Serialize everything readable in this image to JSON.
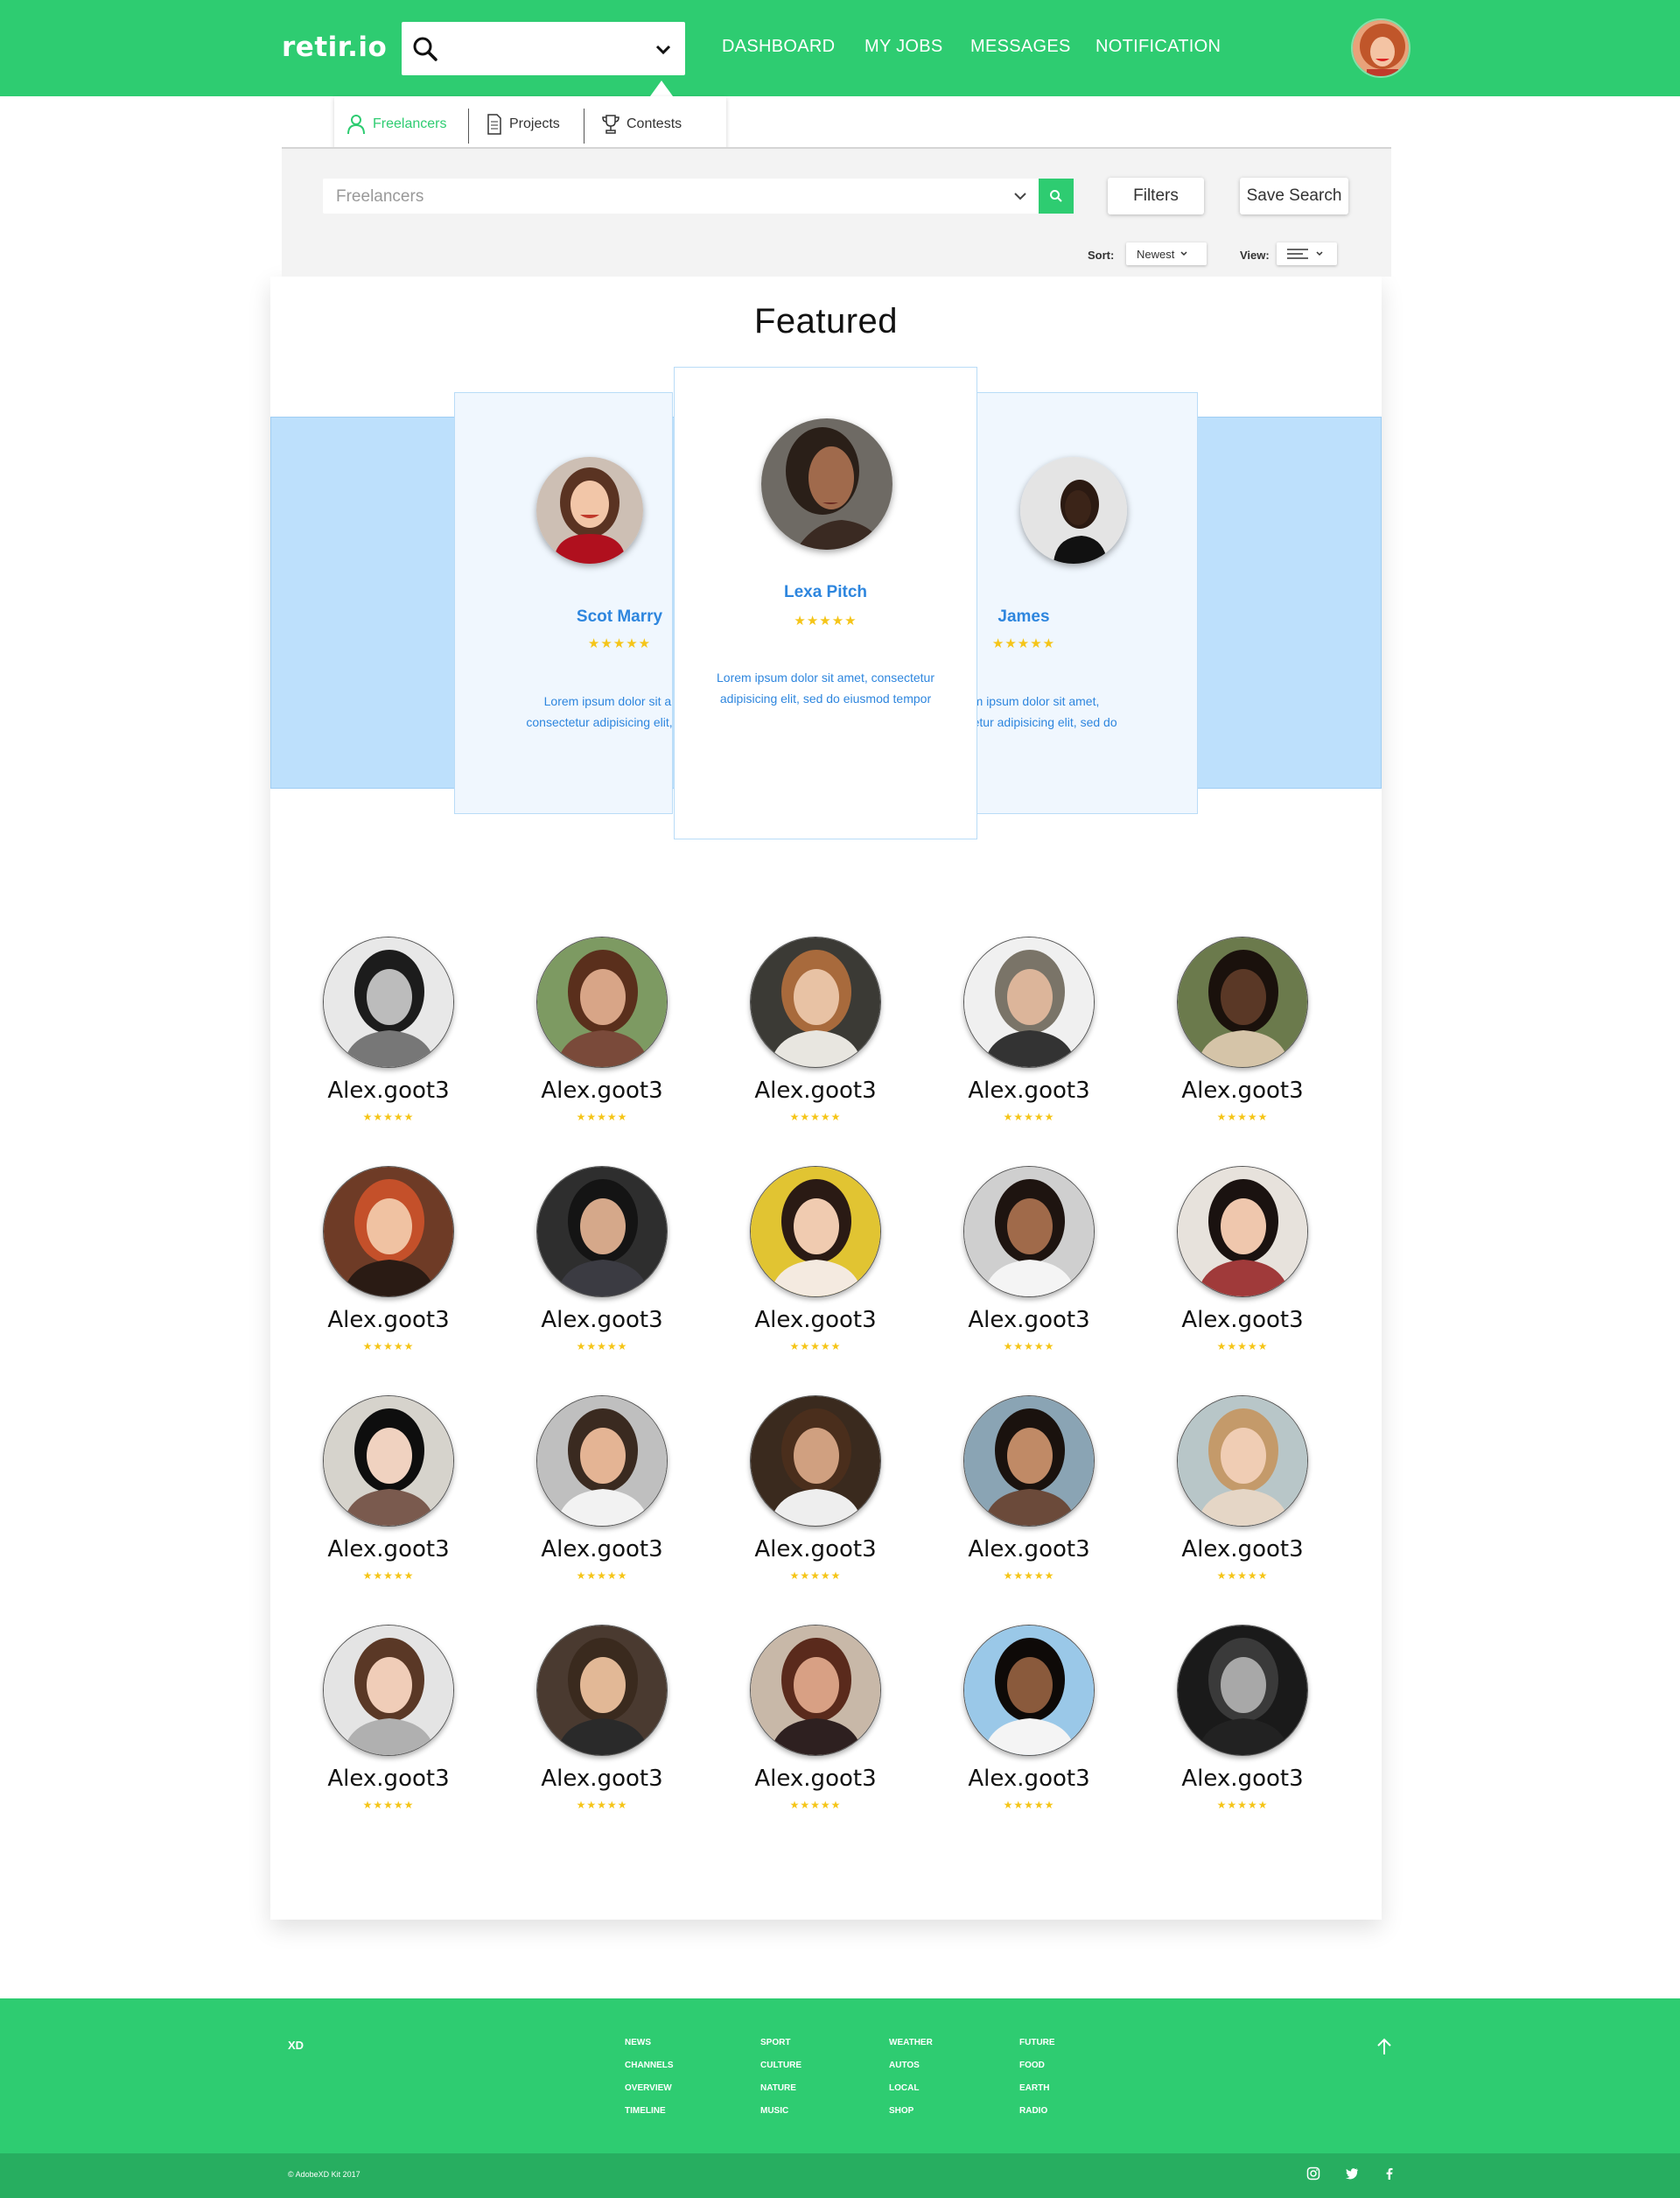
{
  "app": {
    "logo": "retir.io",
    "nav": [
      "DASHBOARD",
      "MY JOBS",
      "MESSAGES",
      "NOTIFICATION"
    ],
    "search": {
      "value": "",
      "placeholder": ""
    }
  },
  "search_tabs": [
    {
      "label": "Freelancers",
      "icon": "user-icon",
      "active": true
    },
    {
      "label": "Projects",
      "icon": "document-icon",
      "active": false
    },
    {
      "label": "Contests",
      "icon": "trophy-icon",
      "active": false
    }
  ],
  "toolbar": {
    "category": "Freelancers",
    "filters_label": "Filters",
    "save_search_label": "Save Search",
    "sort_label": "Sort:",
    "sort_value": "Newest",
    "view_label": "View:",
    "view_icon": "list-view-icon"
  },
  "featured": {
    "title": "Featured",
    "cards": [
      {
        "name": "Scot Marry",
        "rating": "★★★★★",
        "desc1": "Lorem ipsum dolor sit amet,",
        "desc2": "consectetur adipisicing elit, sed do"
      },
      {
        "name": "Lexa Pitch",
        "rating": "★★★★★",
        "desc1": "Lorem ipsum dolor sit amet, consectetur",
        "desc2": "adipisicing elit, sed do eiusmod tempor"
      },
      {
        "name": "James",
        "rating": "★★★★★",
        "desc1": "Lorem ipsum dolor sit amet,",
        "desc2": "consectetur adipisicing elit, sed do"
      }
    ]
  },
  "freelancers": [
    {
      "name": "Alex.goot3",
      "rating": "★★★★★"
    },
    {
      "name": "Alex.goot3",
      "rating": "★★★★★"
    },
    {
      "name": "Alex.goot3",
      "rating": "★★★★★"
    },
    {
      "name": "Alex.goot3",
      "rating": "★★★★★"
    },
    {
      "name": "Alex.goot3",
      "rating": "★★★★★"
    },
    {
      "name": "Alex.goot3",
      "rating": "★★★★★"
    },
    {
      "name": "Alex.goot3",
      "rating": "★★★★★"
    },
    {
      "name": "Alex.goot3",
      "rating": "★★★★★"
    },
    {
      "name": "Alex.goot3",
      "rating": "★★★★★"
    },
    {
      "name": "Alex.goot3",
      "rating": "★★★★★"
    },
    {
      "name": "Alex.goot3",
      "rating": "★★★★★"
    },
    {
      "name": "Alex.goot3",
      "rating": "★★★★★"
    },
    {
      "name": "Alex.goot3",
      "rating": "★★★★★"
    },
    {
      "name": "Alex.goot3",
      "rating": "★★★★★"
    },
    {
      "name": "Alex.goot3",
      "rating": "★★★★★"
    },
    {
      "name": "Alex.goot3",
      "rating": "★★★★★"
    },
    {
      "name": "Alex.goot3",
      "rating": "★★★★★"
    },
    {
      "name": "Alex.goot3",
      "rating": "★★★★★"
    },
    {
      "name": "Alex.goot3",
      "rating": "★★★★★"
    },
    {
      "name": "Alex.goot3",
      "rating": "★★★★★"
    }
  ],
  "footer": {
    "brand": "XD",
    "columns": [
      [
        "NEWS",
        "CHANNELS",
        "OVERVIEW",
        "TIMELINE"
      ],
      [
        "SPORT",
        "CULTURE",
        "NATURE",
        "MUSIC"
      ],
      [
        "WEATHER",
        "AUTOS",
        "LOCAL",
        "SHOP"
      ],
      [
        "FUTURE",
        "FOOD",
        "EARTH",
        "RADIO"
      ]
    ],
    "copyright": "© AdobeXD Kit 2017",
    "social_icons": [
      "instagram-icon",
      "twitter-icon",
      "facebook-icon"
    ]
  },
  "colors": {
    "brand_green": "#2ecc71",
    "link_blue": "#2e86de",
    "star": "#f5c518",
    "band_blue": "#bde0fc"
  }
}
